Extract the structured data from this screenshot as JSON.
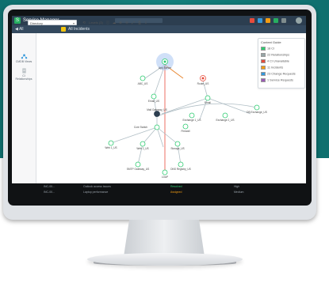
{
  "app": {
    "title": "Service Manager",
    "brand_letter": "S"
  },
  "subbar": {
    "left_label": "◀ All",
    "tab_label": "All Incidents"
  },
  "sidebar": {
    "items": [
      {
        "label": "CMDB Views",
        "icon": "network-icon"
      },
      {
        "label": "CI Relationships",
        "icon": "document-icon"
      }
    ]
  },
  "toolbar": {
    "view_select": "Directory",
    "levels_label": "Levels (3)"
  },
  "legend": {
    "title": "Context Guide",
    "items": [
      {
        "label": "18 CI",
        "color": "#2ecc71"
      },
      {
        "label": "22 Relationships",
        "color": "#95a5a6"
      },
      {
        "label": "4 CI Unavailable",
        "color": "#e74c3c"
      },
      {
        "label": "11 Incidents",
        "color": "#f39c12"
      },
      {
        "label": "23 Change Requests",
        "color": "#3498db"
      },
      {
        "label": "1 Service Requests",
        "color": "#9b59b6"
      }
    ]
  },
  "graph": {
    "nodes": [
      {
        "label": "App Server",
        "kind": "focus"
      },
      {
        "label": "ABC_US",
        "kind": "normal"
      },
      {
        "label": "Email_US",
        "kind": "normal"
      },
      {
        "label": "Route_US",
        "kind": "alert"
      },
      {
        "label": "Email",
        "kind": "normal"
      },
      {
        "label": "Mail Gateway_US",
        "kind": "normal"
      },
      {
        "label": "Exchange 1_US",
        "kind": "normal"
      },
      {
        "label": "Exchange 2_US",
        "kind": "normal"
      },
      {
        "label": "DB Exchange_US",
        "kind": "normal"
      },
      {
        "label": "Firewall",
        "kind": "normal"
      },
      {
        "label": "Web 1_US",
        "kind": "normal"
      },
      {
        "label": "Web 2_US",
        "kind": "normal"
      },
      {
        "label": "Core Switch",
        "kind": "normal"
      },
      {
        "label": "Storage_US",
        "kind": "normal"
      },
      {
        "label": "SMTP Gateway_US",
        "kind": "normal"
      },
      {
        "label": "DNS Registry_US",
        "kind": "normal"
      },
      {
        "label": "LDAP",
        "kind": "normal"
      }
    ]
  },
  "table_rows": [
    {
      "id": "INC-00...",
      "title": "Outlook access issues",
      "status": "Resolved",
      "priority": "High"
    },
    {
      "id": "INC-00...",
      "title": "Laptop performance",
      "status": "Assigned",
      "priority": "Medium"
    }
  ],
  "colors": {
    "teal_bg": "#13807d",
    "header": "#2c3e50",
    "ci_green": "#2ecc71",
    "alert_red": "#e74c3c",
    "edge_orange": "#e67e22"
  }
}
